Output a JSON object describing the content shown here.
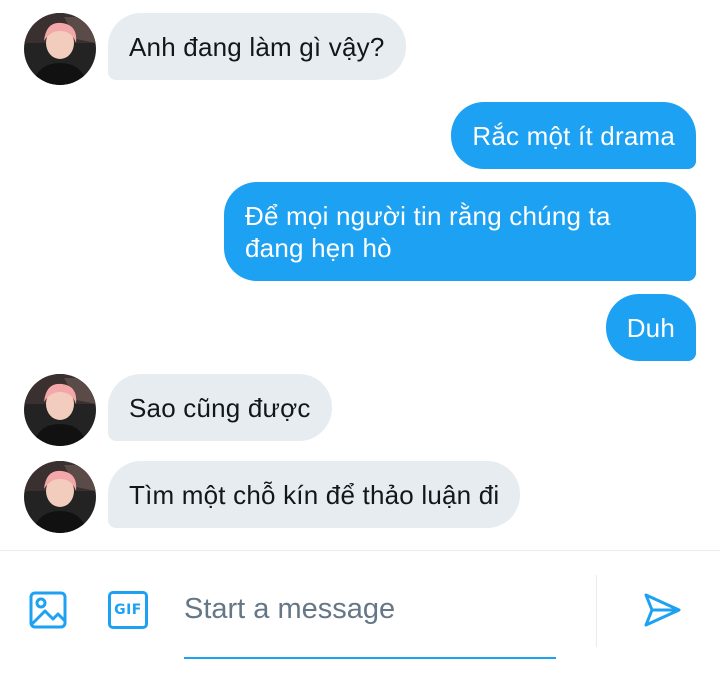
{
  "conversation": {
    "messages": [
      {
        "direction": "in",
        "text": "Anh đang làm gì vậy?"
      },
      {
        "direction": "out",
        "text": "Rắc một ít drama"
      },
      {
        "direction": "out",
        "text": "Để mọi người tin rằng chúng ta đang hẹn hò"
      },
      {
        "direction": "out",
        "text": "Duh"
      },
      {
        "direction": "in",
        "text": "Sao cũng được"
      },
      {
        "direction": "in",
        "text": "Tìm một chỗ kín để thảo luận đi"
      }
    ]
  },
  "composer": {
    "placeholder": "Start a message",
    "value": "",
    "media_icon": "image-icon",
    "gif_label": "GIF",
    "send_icon": "send-icon"
  },
  "colors": {
    "accent": "#1da1f2",
    "incoming_bubble": "#e6ecf0",
    "incoming_text": "#14171a",
    "outgoing_text": "#ffffff",
    "placeholder": "#657786"
  }
}
